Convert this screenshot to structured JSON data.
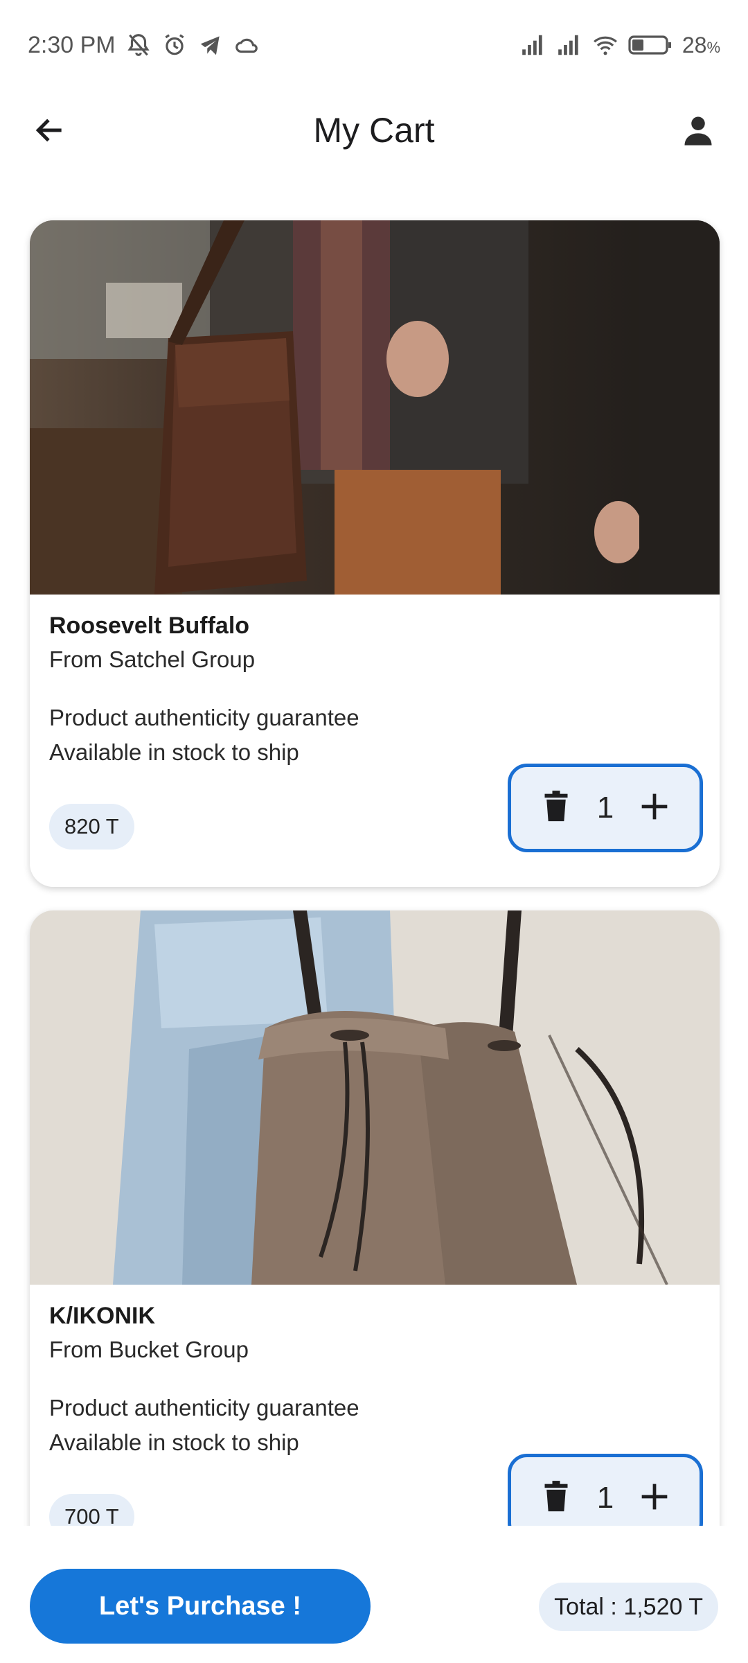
{
  "status_bar": {
    "time": "2:30 PM",
    "battery": "28",
    "battery_unit": "%",
    "icons": [
      "bell-off-icon",
      "alarm-icon",
      "telegram-icon",
      "cloud-icon",
      "signal-icon",
      "signal-icon",
      "wifi-icon",
      "battery-icon"
    ]
  },
  "header": {
    "title": "My Cart",
    "back_icon": "arrow-left-icon",
    "profile_icon": "person-icon"
  },
  "cart_items": [
    {
      "name": "Roosevelt Buffalo",
      "group": "From Satchel Group",
      "feature_1": "Product authenticity guarantee",
      "feature_2": "Available in stock to ship",
      "price": "820 T",
      "quantity": "1",
      "image": "brown leather satchel bag worn by man in tweed jacket"
    },
    {
      "name": "K/IKONIK",
      "group": "From Bucket Group",
      "feature_1": "Product authenticity guarantee",
      "feature_2": "Available in stock to ship",
      "price": "700 T",
      "quantity": "1",
      "image": "taupe leather bucket bag with drawstring"
    }
  ],
  "footer": {
    "purchase_label": "Let's Purchase !",
    "total_label": "Total : 1,520 T"
  },
  "colors": {
    "accent": "#1677d9",
    "chip_bg": "#e6eef8",
    "qty_border": "#1a6fd3"
  }
}
